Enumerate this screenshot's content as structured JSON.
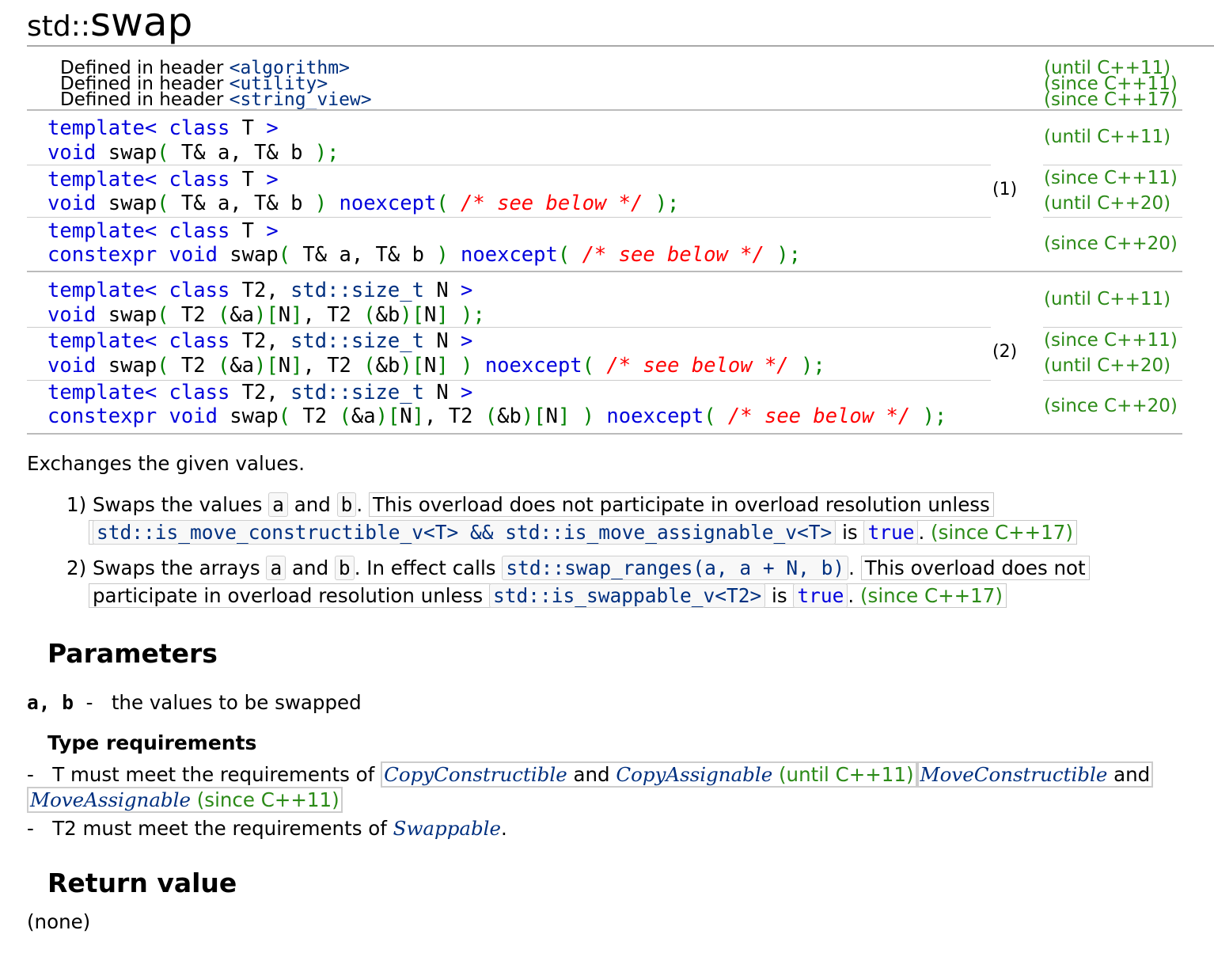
{
  "title": {
    "namespace": "std::",
    "name": "swap"
  },
  "headers": [
    {
      "prefix": "Defined in header",
      "header": "<algorithm>",
      "rev": "(until C++11)"
    },
    {
      "prefix": "Defined in header",
      "header": "<utility>",
      "rev": "(since C++11)"
    },
    {
      "prefix": "Defined in header",
      "header": "<string_view>",
      "rev": "(since C++17)"
    }
  ],
  "group1": {
    "number": "(1)",
    "r1": {
      "rev": "(until C++11)"
    },
    "r2": {
      "rev1": "(since C++11)",
      "rev2": "(until C++20)"
    },
    "r3": {
      "rev": "(since C++20)"
    }
  },
  "group2": {
    "number": "(2)",
    "r1": {
      "rev": "(until C++11)"
    },
    "r2": {
      "rev1": "(since C++11)",
      "rev2": "(until C++20)"
    },
    "r3": {
      "rev": "(since C++20)"
    }
  },
  "tokens": {
    "template": "template",
    "class": "class",
    "void": "void",
    "constexpr": "constexpr",
    "noexcept": "noexcept",
    "std_size_t": "std::size_t",
    "see_below": "/* see below */"
  },
  "description": "Exchanges the given values.",
  "item1": {
    "num": "1)",
    "t1": "Swaps the values",
    "a": "a",
    "and": "and",
    "b": "b",
    "dot": ".",
    "note": "This overload does not participate in overload resolution unless",
    "expr": "std::is_move_constructible_v<T> && std::is_move_assignable_v<T>",
    "is": "is",
    "true": "true",
    "rev": "(since C++17)"
  },
  "item2": {
    "num": "2)",
    "t1": "Swaps the arrays",
    "a": "a",
    "and": "and",
    "b": "b",
    "t2": ". In effect calls",
    "call": "std::swap_ranges(a, a + N, b)",
    "dot": ".",
    "note1": "This overload does not",
    "note2": "participate in overload resolution unless",
    "expr": "std::is_swappable_v<T2>",
    "is": "is",
    "true": "true",
    "rev": "(since C++17)"
  },
  "parameters": {
    "heading": "Parameters",
    "name": "a, b",
    "dash": "-",
    "desc": "the values to be swapped"
  },
  "type_requirements": {
    "heading": "Type requirements",
    "dash": "-",
    "req1_text": "T must meet the requirements of",
    "copy_constructible": "CopyConstructible",
    "and": "and",
    "copy_assignable": "CopyAssignable",
    "until11": "(until C++11)",
    "move_constructible": "MoveConstructible",
    "move_assignable": "MoveAssignable",
    "since11": "(since C++11)",
    "req2_text": "T2 must meet the requirements of",
    "swappable": "Swappable",
    "period": "."
  },
  "return_value": {
    "heading": "Return value",
    "text": "(none)"
  }
}
